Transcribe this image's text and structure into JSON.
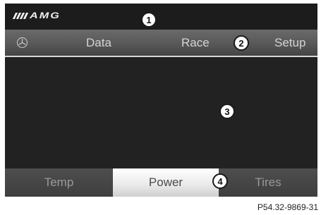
{
  "header": {
    "logo_text": "AMG"
  },
  "nav": {
    "items": [
      {
        "icon": "mercedes-star-icon"
      },
      {
        "label": "Data"
      },
      {
        "label": "Race"
      },
      {
        "label": "Setup"
      }
    ]
  },
  "bottom_tabs": {
    "items": [
      {
        "label": "Temp",
        "active": false
      },
      {
        "label": "Power",
        "active": true
      },
      {
        "label": "Tires",
        "active": false
      }
    ]
  },
  "callouts": [
    "1",
    "2",
    "3",
    "4"
  ],
  "figure_ref": "P54.32-9869-31",
  "colors": {
    "screen_bg": "#202020",
    "bar_gray": "#5a5a5a",
    "active_tab": "#ffffff",
    "text_light": "#d4d4d4"
  }
}
